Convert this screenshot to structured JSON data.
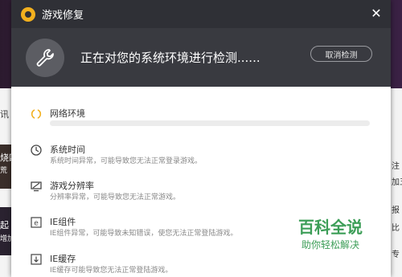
{
  "dialog": {
    "title": "游戏修复",
    "status_text": "正在对您的系统环境进行检测......",
    "cancel_label": "取消检测"
  },
  "checks": [
    {
      "name": "网络环境",
      "desc": "",
      "icon": "loading-spinner-icon",
      "progress": 0
    },
    {
      "name": "系统时间",
      "desc": "系统时间异常，可能导致您无法正常登录游戏。",
      "icon": "clock-icon"
    },
    {
      "name": "游戏分辨率",
      "desc": "分辨率异常，可能导致您无法正常游戏。",
      "icon": "monitor-icon"
    },
    {
      "name": "IE组件",
      "desc": "IE组件异常，可能导致未知错误，使您无法正常登陆游戏。",
      "icon": "ie-icon"
    },
    {
      "name": "IE缓存",
      "desc": "IE缓存可能导致您无法正常登陆游戏。",
      "icon": "download-icon"
    }
  ],
  "background": {
    "left_texts": [
      "讯",
      "烧四",
      "荒",
      "起",
      "增加"
    ],
    "right_texts": [
      "注",
      "加五",
      "报",
      "比",
      "专"
    ]
  },
  "watermark": {
    "title": "百科全说",
    "subtitle": "助你轻松解决"
  },
  "colors": {
    "titlebar": "#2f3036",
    "header": "#393a40",
    "logo": "#f2b01e",
    "spinner": "#f2b01e",
    "watermark": "#3d9e58"
  }
}
